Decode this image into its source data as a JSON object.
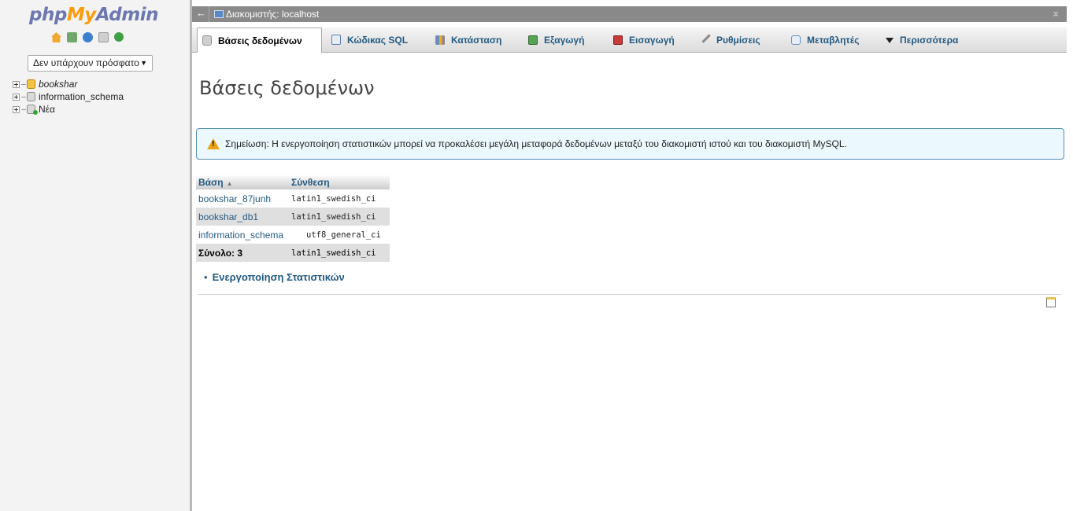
{
  "sidebar": {
    "logo": {
      "part1": "php",
      "part2": "My",
      "part3": "Admin"
    },
    "quick_icons": [
      "home-icon",
      "logout-icon",
      "help-icon",
      "documentation-icon",
      "reload-icon"
    ],
    "recent": {
      "selected": "Δεν υπάρχουν πρόσφατο"
    },
    "tree": [
      {
        "label": "bookshar",
        "icon": "database-group-icon"
      },
      {
        "label": "information_schema",
        "icon": "database-icon"
      },
      {
        "label": "Νέα",
        "icon": "new-database-icon"
      }
    ]
  },
  "serverbar": {
    "label": "Διακομιστής: localhost",
    "back": "←",
    "collapse": "⌅"
  },
  "tabs": [
    {
      "label": "Βάσεις δεδομένων",
      "icon": "database-icon",
      "active": true
    },
    {
      "label": "Κώδικας SQL",
      "icon": "sql-icon"
    },
    {
      "label": "Κατάσταση",
      "icon": "status-icon"
    },
    {
      "label": "Εξαγωγή",
      "icon": "export-icon"
    },
    {
      "label": "Εισαγωγή",
      "icon": "import-icon"
    },
    {
      "label": "Ρυθμίσεις",
      "icon": "settings-icon"
    },
    {
      "label": "Μεταβλητές",
      "icon": "variables-icon"
    },
    {
      "label": "Περισσότερα",
      "icon": "dropdown-arrow-icon"
    }
  ],
  "page": {
    "title": "Βάσεις δεδομένων",
    "notice": "Σημείωση: Η ενεργοποίηση στατιστικών μπορεί να προκαλέσει μεγάλη μεταφορά δεδομένων μεταξύ του διακομιστή ιστού και του διακομιστή MySQL.",
    "table": {
      "headers": {
        "database": "Βάση",
        "collation": "Σύνθεση"
      },
      "rows": [
        {
          "name": "bookshar_87junh",
          "collation": "latin1_swedish_ci"
        },
        {
          "name": "bookshar_db1",
          "collation": "latin1_swedish_ci"
        },
        {
          "name": "information_schema",
          "collation": "utf8_general_ci"
        }
      ],
      "total": {
        "label": "Σύνολο: 3",
        "collation": "latin1_swedish_ci"
      }
    },
    "enable_stats": "Ενεργοποίηση Στατιστικών"
  },
  "colors": {
    "link": "#235a81",
    "serverbar": "#898989",
    "notice_bg": "#ebf8fd",
    "notice_border": "#528fb1",
    "logo_blue": "#6c78af",
    "logo_orange": "#f89c0e"
  }
}
